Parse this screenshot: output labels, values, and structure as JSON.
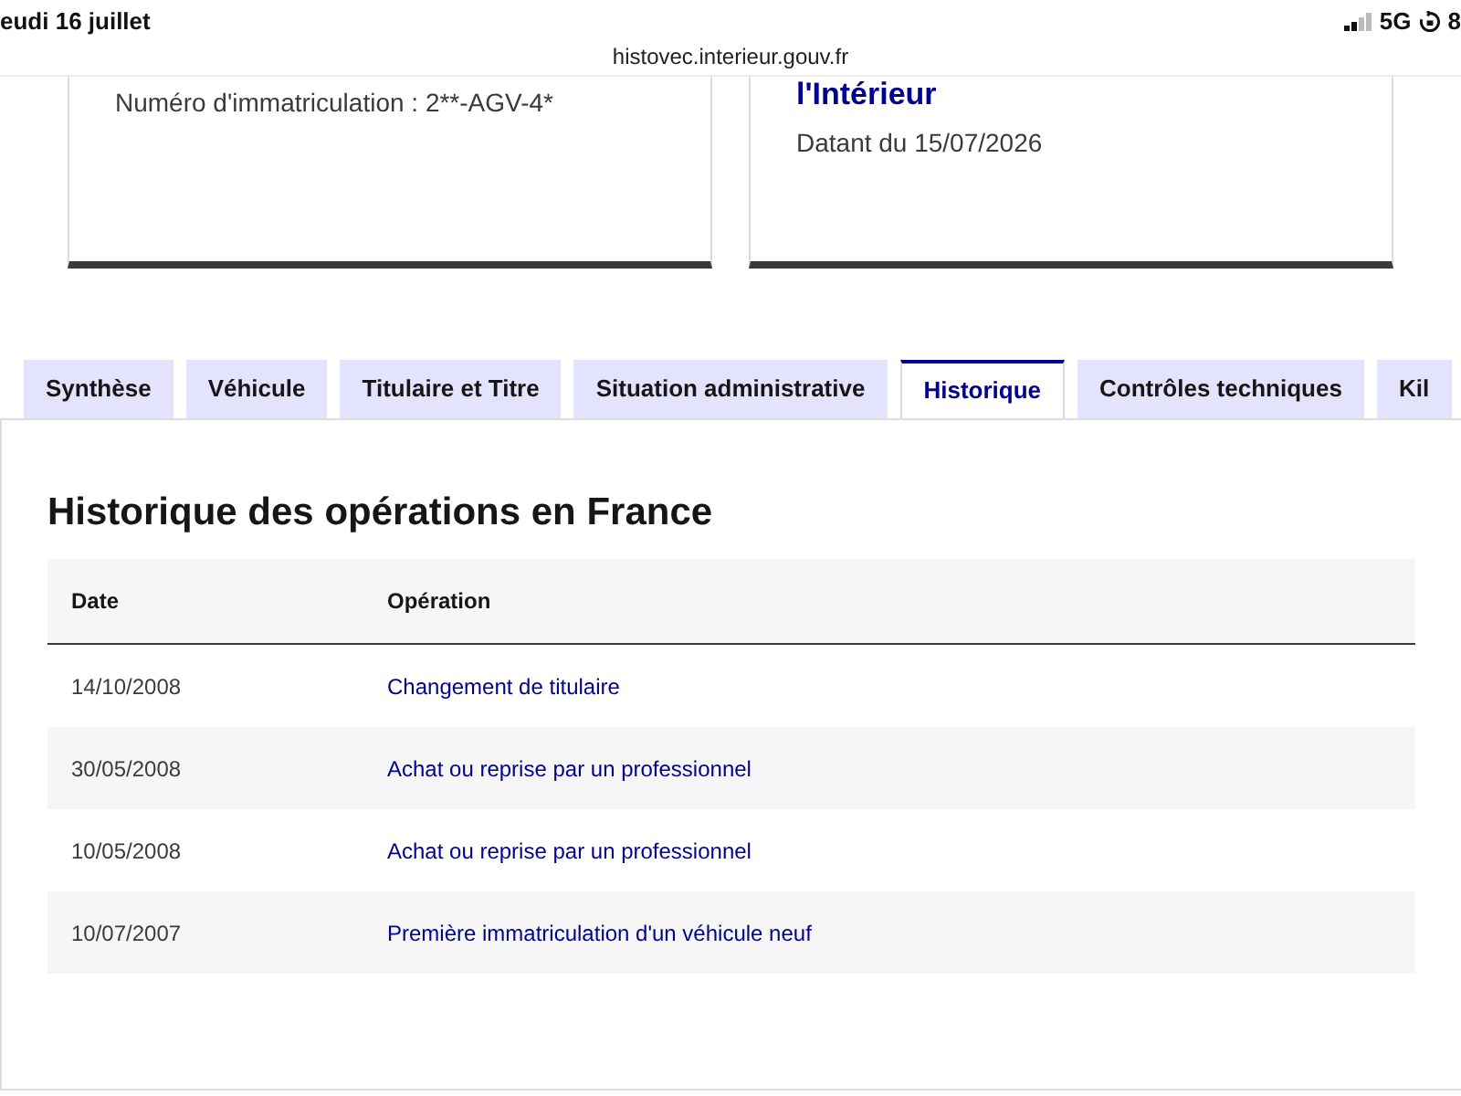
{
  "status_bar": {
    "date": "eudi 16 juillet",
    "network": "5G",
    "battery": "8"
  },
  "address_bar": {
    "url": "histovec.interieur.gouv.fr"
  },
  "cards": [
    {
      "text": "Numéro d'immatriculation : 2**-AGV-4*"
    },
    {
      "title": "l'Intérieur",
      "text": "Datant du 15/07/2026"
    }
  ],
  "tabs": [
    {
      "label": "Synthèse",
      "selected": false
    },
    {
      "label": "Véhicule",
      "selected": false
    },
    {
      "label": "Titulaire et Titre",
      "selected": false
    },
    {
      "label": "Situation administrative",
      "selected": false
    },
    {
      "label": "Historique",
      "selected": true
    },
    {
      "label": "Contrôles techniques",
      "selected": false
    },
    {
      "label": "Kil",
      "selected": false
    }
  ],
  "panel": {
    "heading": "Historique des opérations en France"
  },
  "table": {
    "columns": [
      "Date",
      "Opération"
    ],
    "rows": [
      [
        "14/10/2008",
        "Changement de titulaire"
      ],
      [
        "30/05/2008",
        "Achat ou reprise par un professionnel"
      ],
      [
        "10/05/2008",
        "Achat ou reprise par un professionnel"
      ],
      [
        "10/07/2007",
        "Première immatriculation d'un véhicule neuf"
      ]
    ]
  }
}
